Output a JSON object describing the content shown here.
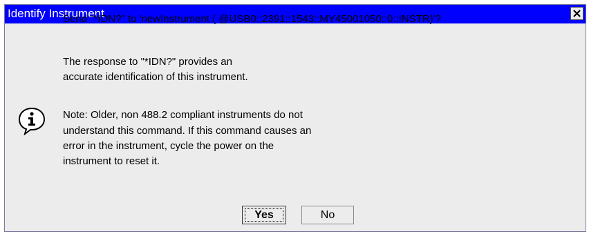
{
  "window": {
    "title": "Identify Instrument",
    "title_bar_color": "#0000ff",
    "close_icon": "close-icon"
  },
  "message": {
    "icon": "info-icon",
    "question": "Send \"*IDN?\" to 'newInstrument   ( @USB0::2391::1543::MY45001050::0::INSTR)'?",
    "response_line1": "The response to \"*IDN?\" provides an",
    "response_line2": "accurate identification of this instrument.",
    "note_line1": "Note: Older, non 488.2 compliant instruments do not",
    "note_line2": "understand this command. If this command causes an",
    "note_line3": "error in the instrument, cycle the power on the",
    "note_line4": "instrument to reset it."
  },
  "buttons": {
    "yes_label": "Yes",
    "no_label": "No"
  }
}
